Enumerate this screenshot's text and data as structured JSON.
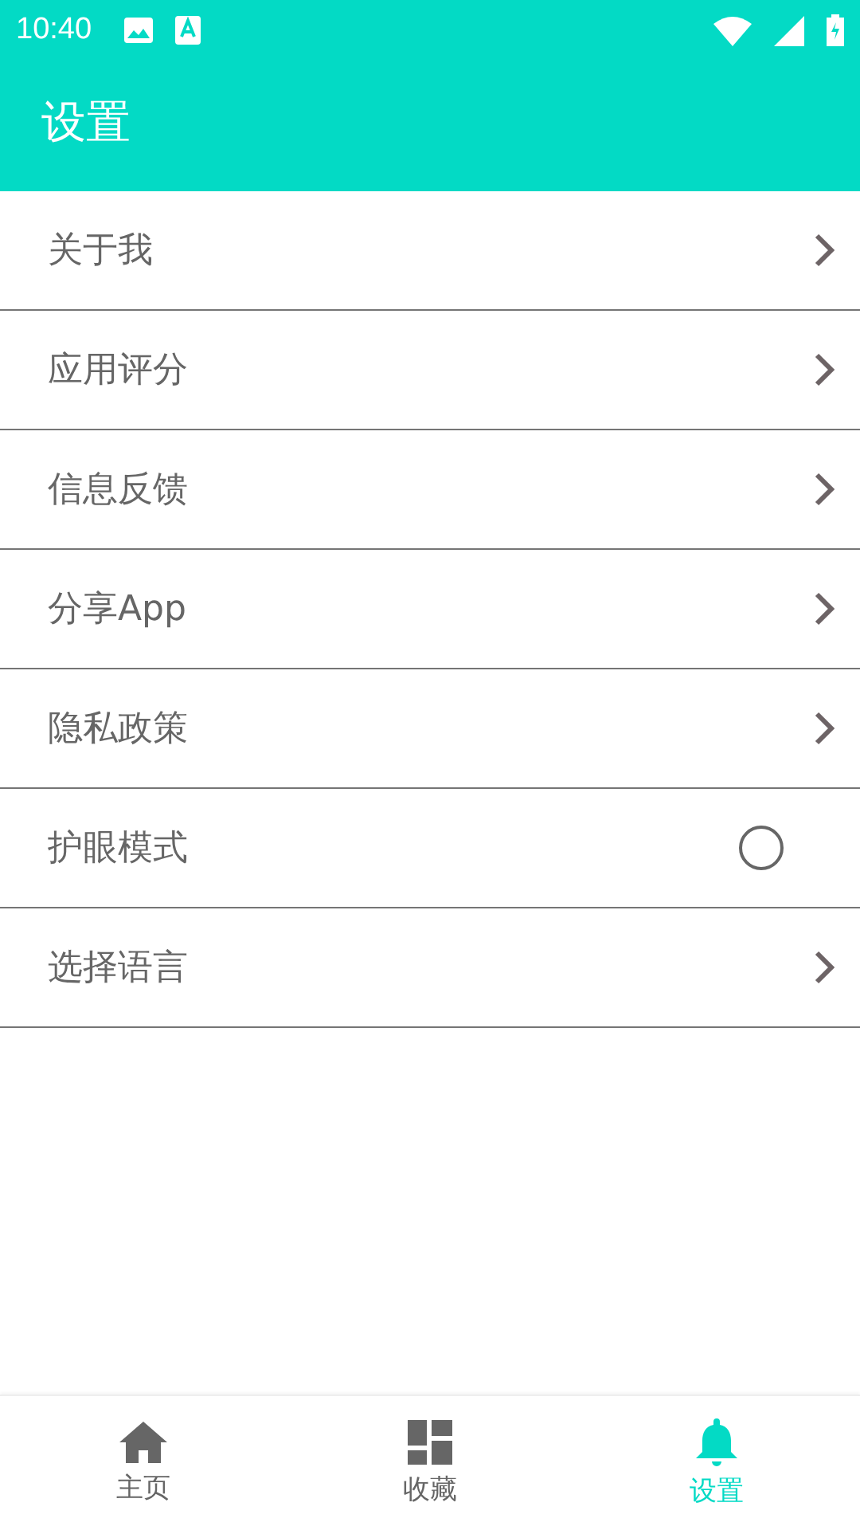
{
  "status_bar": {
    "time": "10:40"
  },
  "app_bar": {
    "title": "设置"
  },
  "settings": [
    {
      "label": "关于我",
      "kind": "link"
    },
    {
      "label": "应用评分",
      "kind": "link"
    },
    {
      "label": "信息反馈",
      "kind": "link"
    },
    {
      "label": "分享App",
      "kind": "link"
    },
    {
      "label": "隐私政策",
      "kind": "link"
    },
    {
      "label": "护眼模式",
      "kind": "toggle",
      "checked": false
    },
    {
      "label": "选择语言",
      "kind": "link"
    }
  ],
  "bottom_nav": [
    {
      "label": "主页",
      "kind": "home",
      "selected": false
    },
    {
      "label": "收藏",
      "kind": "dashboard",
      "selected": false
    },
    {
      "label": "设置",
      "kind": "bell",
      "selected": true
    }
  ]
}
